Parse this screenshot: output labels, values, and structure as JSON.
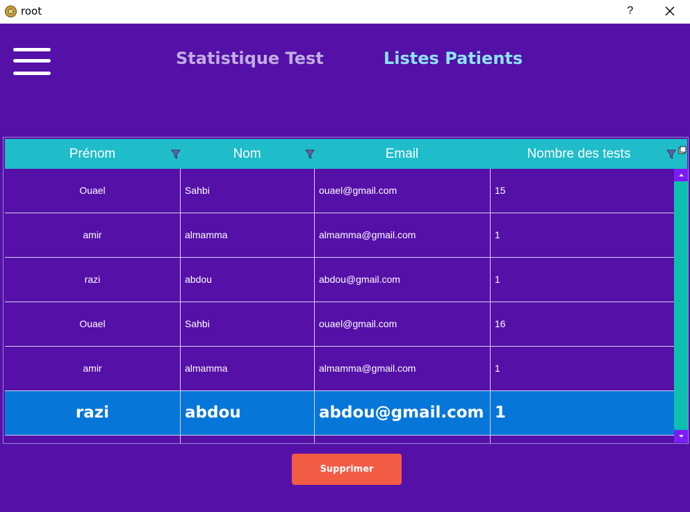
{
  "window": {
    "title": "root",
    "help_label": "?"
  },
  "nav": {
    "stat_label": "Statistique Test",
    "list_label": "Listes Patients"
  },
  "table": {
    "columns": [
      "Prénom",
      "Nom",
      "Email",
      "Nombre des tests"
    ],
    "rows": [
      [
        "Ouael",
        "Sahbi",
        "ouael@gmail.com",
        "15"
      ],
      [
        "amir",
        "almamma",
        "almamma@gmail.com",
        "1"
      ],
      [
        "razi",
        "abdou",
        "abdou@gmail.com",
        "1"
      ],
      [
        "Ouael",
        "Sahbi",
        "ouael@gmail.com",
        "16"
      ],
      [
        "amir",
        "almamma",
        "almamma@gmail.com",
        "1"
      ],
      [
        "razi",
        "abdou",
        "abdou@gmail.com",
        "1"
      ]
    ],
    "selected_row": 5
  },
  "actions": {
    "delete_label": "Supprimer"
  },
  "colors": {
    "background": "#5510a8",
    "header": "#1fbcca",
    "selected_row": "#0677d8",
    "delete_button": "#f25c45",
    "nav_active": "#8ce4f6",
    "nav_inactive": "#c0aee0"
  },
  "icons": {
    "app": "python-gear-icon",
    "close": "close-icon",
    "menu": "hamburger-menu-icon",
    "filter": "filter-funnel-icon",
    "column_chooser": "column-chooser-icon",
    "scroll_up": "arrow-up-icon",
    "scroll_down": "arrow-down-icon"
  }
}
